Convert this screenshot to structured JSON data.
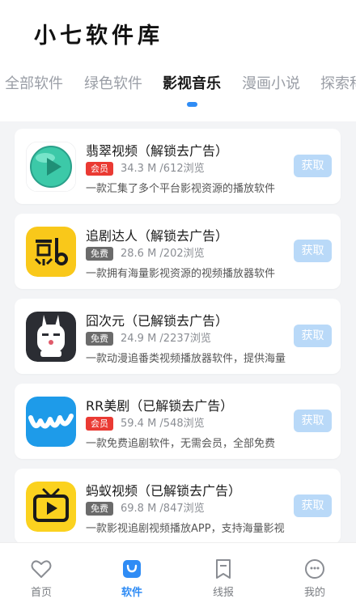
{
  "app": {
    "title": "小七软件库"
  },
  "tabs": [
    {
      "label": "全部软件",
      "active": false
    },
    {
      "label": "绿色软件",
      "active": false
    },
    {
      "label": "影视音乐",
      "active": true
    },
    {
      "label": "漫画小说",
      "active": false
    },
    {
      "label": "探索科技",
      "active": false
    }
  ],
  "apps": [
    {
      "title": "翡翠视频（解锁去广告）",
      "badge": "会员",
      "badge_type": "vip",
      "meta": "34.3 M /612浏览",
      "desc": "一款汇集了多个平台影视资源的播放软件",
      "button": "获取",
      "icon": "jade-play-icon"
    },
    {
      "title": "追剧达人（解锁去广告）",
      "badge": "免费",
      "badge_type": "free",
      "meta": "28.6 M /202浏览",
      "desc": "一款拥有海量影视资源的视频播放器软件",
      "button": "获取",
      "icon": "zhuijudaren-logo-icon"
    },
    {
      "title": "囧次元（已解锁去广告）",
      "badge": "免费",
      "badge_type": "free",
      "meta": "24.9 M /2237浏览",
      "desc": "一款动漫追番类视频播放器软件，提供海量",
      "button": "获取",
      "icon": "rabbit-mascot-icon"
    },
    {
      "title": "RR美剧（已解锁去广告）",
      "badge": "会员",
      "badge_type": "vip",
      "meta": "59.4 M /548浏览",
      "desc": "一款免费追剧软件，无需会员，全部免费",
      "button": "获取",
      "icon": "rr-wave-icon"
    },
    {
      "title": "蚂蚁视频（已解锁去广告）",
      "badge": "免费",
      "badge_type": "free",
      "meta": "69.8 M /847浏览",
      "desc": "一款影视追剧视频播放APP，支持海量影视",
      "button": "获取",
      "icon": "tv-play-icon"
    }
  ],
  "bottom_nav": [
    {
      "label": "首页",
      "icon": "heart-icon",
      "active": false
    },
    {
      "label": "软件",
      "icon": "bag-icon",
      "active": true
    },
    {
      "label": "线报",
      "icon": "bookmark-icon",
      "active": false
    },
    {
      "label": "我的",
      "icon": "smiley-icon",
      "active": false
    }
  ],
  "colors": {
    "accent": "#2f8cf5",
    "vip": "#ea3a33",
    "free": "#6b6b6b",
    "button_bg": "#b9d9f8"
  }
}
